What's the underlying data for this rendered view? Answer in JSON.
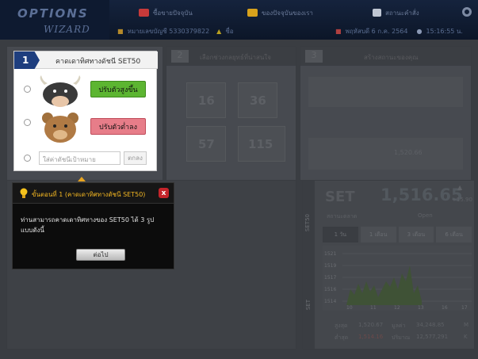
{
  "header": {
    "logo_line1": "OPTIONS",
    "logo_line2": "WIZARD",
    "nav": [
      {
        "label": "ซื้อขายปัจจุบัน",
        "icon": "chart-icon"
      },
      {
        "label": "ของปัจจุบันของเรา",
        "icon": "folder-icon"
      },
      {
        "label": "สถานะคำสั่ง",
        "icon": "document-icon"
      }
    ],
    "settings_icon": "gear-icon",
    "account": "หมายเลขบัญชี 5330379822",
    "user": "ชื่อ",
    "date": "พฤหัสบดี 6 ก.ค. 2564",
    "time": "15:16:55 น."
  },
  "steps": [
    {
      "num": "1",
      "label": "คาดเดาทิศทางดัชนี SET50"
    },
    {
      "num": "2",
      "label": "เลือกช่วงกลยุทธ์ที่น่าสนใจ"
    },
    {
      "num": "3",
      "label": "สร้างสถานะของคุณ"
    }
  ],
  "step1": {
    "num": "1",
    "title": "คาดเดาทิศทางดัชนี SET50",
    "up_label": "ปรับตัวสูงขึ้น",
    "down_label": "ปรับตัวต่ำลง",
    "target_placeholder": "ใส่ค่าดัชนีเป้าหมาย",
    "target_button": "ตกลง"
  },
  "guide": {
    "title": "ขั้นตอนที่ 1 (คาดเดาทิศทางดัชนี SET50)",
    "body": "ท่านสามารถคาดเดาทิศทางของ SET50 ได้ 3 รูปแบบดังนี้",
    "next": "ต่อไป",
    "close": "x"
  },
  "dim": {
    "n1": "16",
    "n2": "36",
    "n3": "57",
    "n4": "115",
    "stepper_value": "1,520.66",
    "side_label": "SET50"
  },
  "setpanel": {
    "name": "SET",
    "value": "1,516.65",
    "change": "+15.90",
    "status_label": "สถานะตลาด",
    "status_value": "Open",
    "tabs": [
      "1 วัน",
      "1 เดือน",
      "3 เดือน",
      "6 เดือน"
    ],
    "yticks": [
      "1521",
      "1519",
      "1517",
      "1516",
      "1514"
    ],
    "xticks": [
      "10",
      "11",
      "12",
      "13",
      "16",
      "17"
    ],
    "high_label": "สูงสุด",
    "high": "1,520.67",
    "low_label": "ต่ำสุด",
    "low": "1,514.16",
    "value_label": "มูลค่า",
    "value_amt": "34,248.85",
    "value_unit": "M",
    "volume_label": "ปริมาณ",
    "volume": "12,577,291",
    "volume_unit": "K",
    "side_label": "SET"
  },
  "colors": {
    "header": "#0c1628",
    "accent": "#1e3e7e",
    "up": "#5cb531",
    "down": "#e77d89",
    "guide_title": "#f2b622",
    "close": "#c4242a"
  }
}
